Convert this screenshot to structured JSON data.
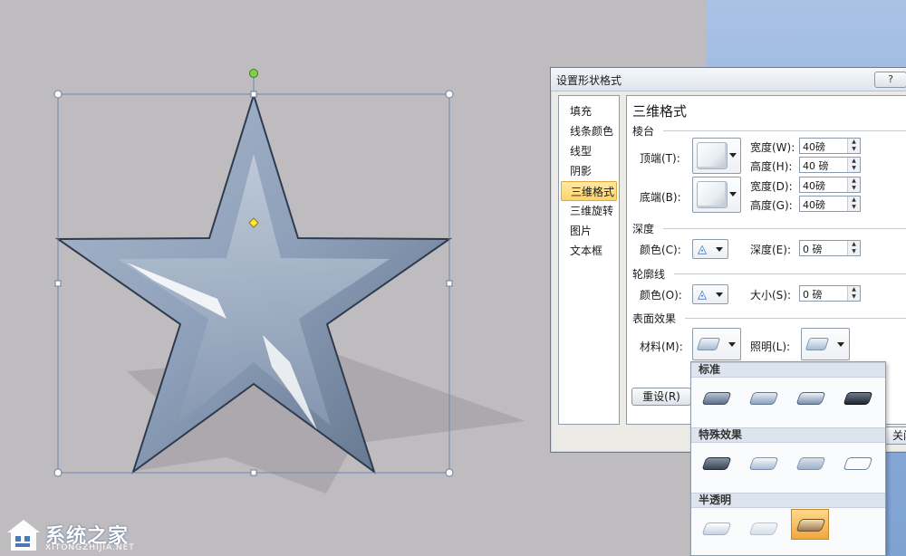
{
  "colors": {
    "slide_bg": "#bfbcc0",
    "dialog_bg": "#ecebe6",
    "nav_active": "#fcd36b",
    "selection_handle": "#ffffff",
    "rotation_handle": "#7fd14a",
    "adjust_handle": "#ffe640"
  },
  "canvas": {
    "shape": "5-point-star",
    "effect": "3D bevel, metal material, drop shadow"
  },
  "dialog": {
    "title": "设置形状格式",
    "help_label": "?",
    "nav": [
      {
        "label": "填充"
      },
      {
        "label": "线条颜色"
      },
      {
        "label": "线型"
      },
      {
        "label": "阴影"
      },
      {
        "label": "三维格式",
        "active": true
      },
      {
        "label": "三维旋转"
      },
      {
        "label": "图片"
      },
      {
        "label": "文本框"
      }
    ],
    "panel_title": "三维格式",
    "bevel": {
      "section": "棱台",
      "top_label": "顶端(T):",
      "bottom_label": "底端(B):",
      "top_width_label": "宽度(W):",
      "top_width": "40磅",
      "top_height_label": "高度(H):",
      "top_height": "40 磅",
      "bottom_width_label": "宽度(D):",
      "bottom_width": "40磅",
      "bottom_height_label": "高度(G):",
      "bottom_height": "40磅"
    },
    "depth": {
      "section": "深度",
      "color_label": "颜色(C):",
      "depth_label": "深度(E):",
      "depth_value": "0 磅"
    },
    "contour": {
      "section": "轮廓线",
      "color_label": "颜色(O):",
      "size_label": "大小(S):",
      "size_value": "0 磅"
    },
    "surface": {
      "section": "表面效果",
      "material_label": "材料(M):",
      "lighting_label": "照明(L):"
    },
    "reset_label": "重设(R)",
    "close_label": "关闭"
  },
  "gallery": {
    "sections": [
      {
        "title": "标准",
        "tiles": [
          "matte",
          "warm-matte",
          "plastic",
          "metal"
        ]
      },
      {
        "title": "特殊效果",
        "tiles": [
          "dark-edge",
          "soft-edge",
          "flat",
          "wireframe"
        ]
      },
      {
        "title": "半透明",
        "tiles": [
          "powder",
          "clear",
          "translucent-powder"
        ]
      }
    ],
    "selected": "translucent-powder"
  },
  "watermark": {
    "name": "系统之家",
    "url": "XITONGZHIJIA.NET"
  }
}
